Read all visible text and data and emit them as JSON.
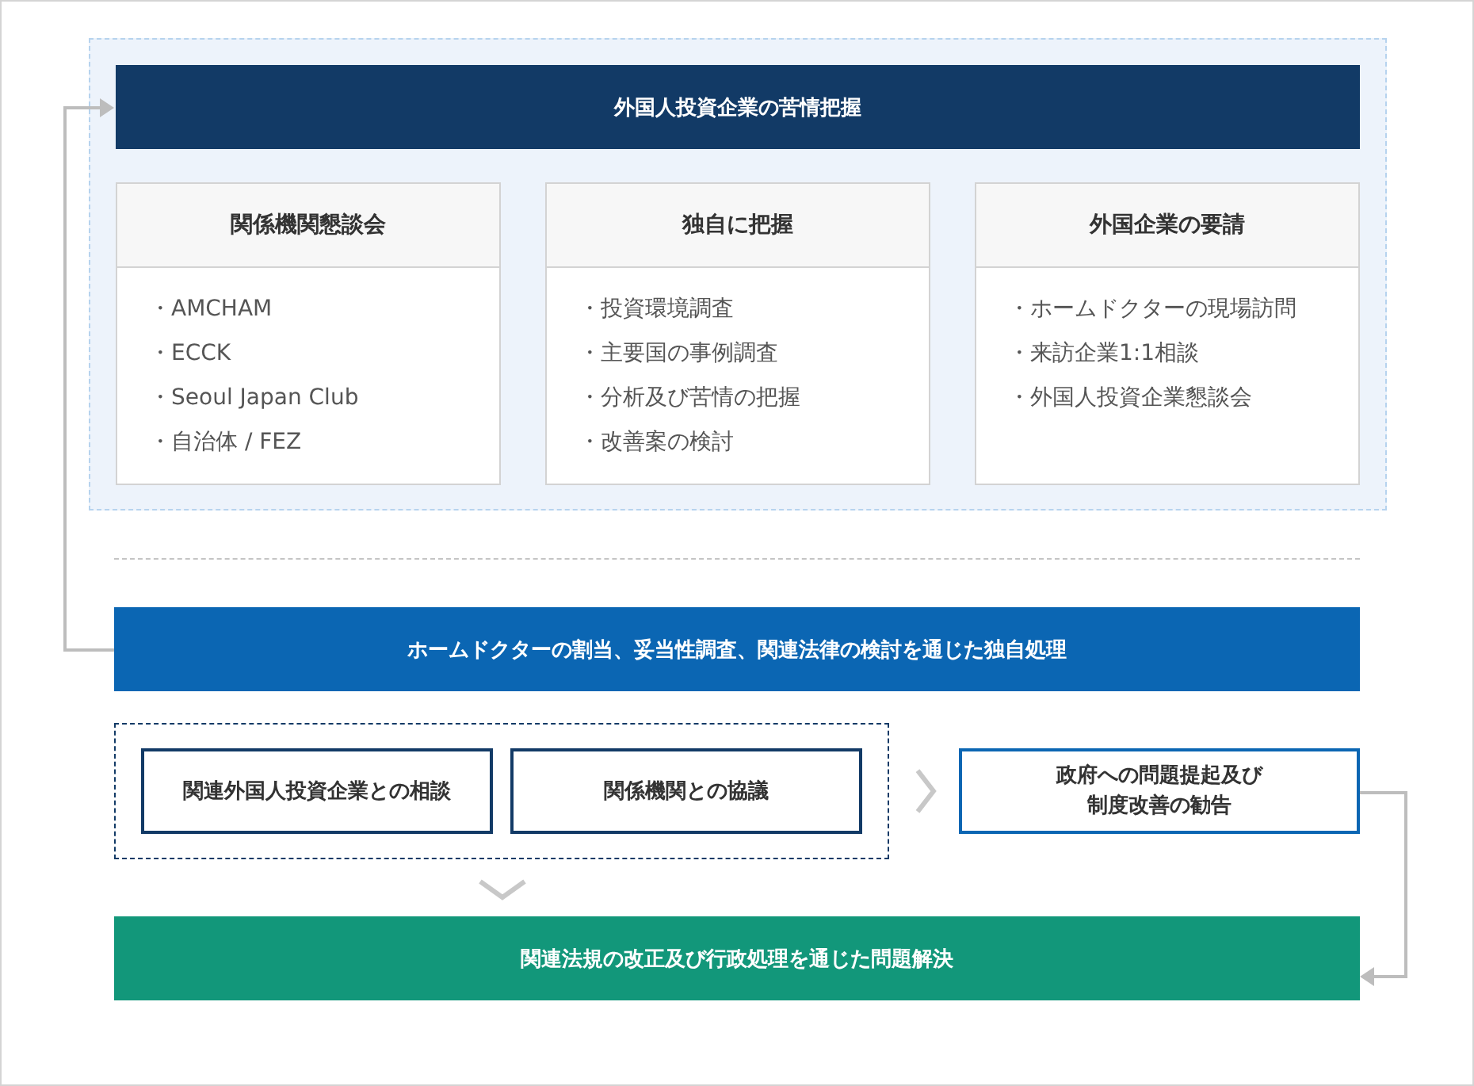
{
  "top_panel": {
    "title": "外国人投資企業の苦情把握",
    "cards": [
      {
        "title": "関係機関懇談会",
        "items": [
          "・AMCHAM",
          "・ECCK",
          "・Seoul Japan Club",
          "・自治体 / FEZ"
        ]
      },
      {
        "title": "独自に把握",
        "items": [
          "・投資環境調査",
          "・主要国の事例調査",
          "・分析及び苦情の把握",
          "・改善案の検討"
        ]
      },
      {
        "title": "外国企業の要請",
        "items": [
          "・ホームドクターの現場訪問",
          "・来訪企業1:1相談",
          "・外国人投資企業懇談会"
        ]
      }
    ]
  },
  "process_bar": "ホームドクターの割当、妥当性調査、関連法律の検討を通じた独自処理",
  "consultations": [
    "関連外国人投資企業との相談",
    "関係機関との協議"
  ],
  "recommendation": [
    "政府への問題提起及び",
    "制度改善の勧告"
  ],
  "resolution_bar": "関連法規の改正及び行政処理を通じた問題解決"
}
